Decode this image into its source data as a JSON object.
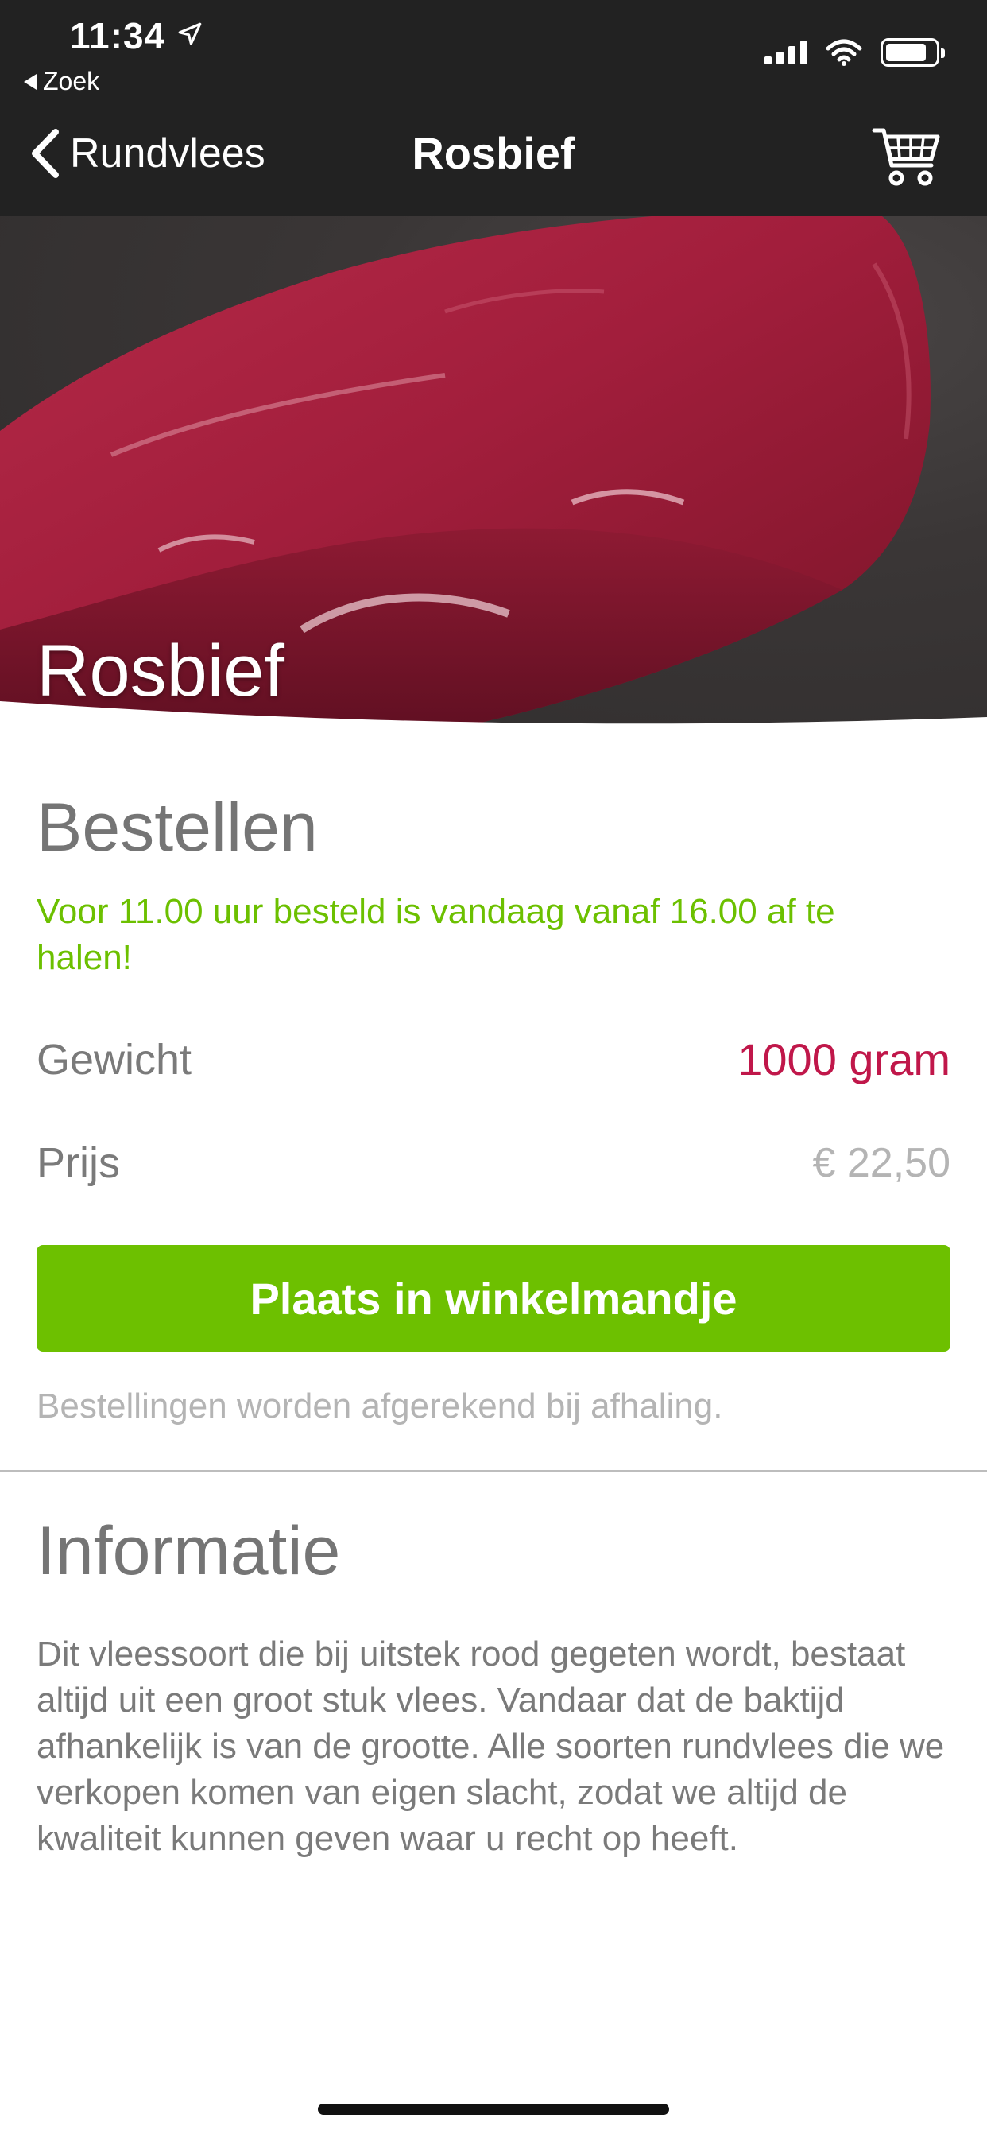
{
  "status_bar": {
    "time": "11:34",
    "back_app_label": "Zoek"
  },
  "nav": {
    "back_label": "Rundvlees",
    "title": "Rosbief"
  },
  "hero": {
    "title": "Rosbief"
  },
  "order": {
    "heading": "Bestellen",
    "notice": "Voor 11.00 uur besteld is vandaag vanaf 16.00 af te halen!",
    "weight_label": "Gewicht",
    "weight_value": "1000 gram",
    "price_label": "Prijs",
    "price_value": "€ 22,50",
    "add_button": "Plaats in winkelmandje",
    "payment_note": "Bestellingen worden afgerekend bij afhaling."
  },
  "info": {
    "heading": "Informatie",
    "text": "Dit vleessoort die bij uitstek rood gegeten wordt, bestaat altijd uit een groot stuk vlees. Vandaar dat de baktijd afhankelijk is van de grootte. Alle soorten rundvlees die we verkopen komen van eigen slacht, zodat we altijd de kwaliteit kunnen geven waar u recht op heeft."
  },
  "colors": {
    "accent_green": "#6dc000",
    "weight_red": "#c0174a",
    "nav_background": "#222222",
    "text_gray": "#7a7a7a"
  },
  "icons": [
    "location-arrow-icon",
    "signal-icon",
    "wifi-icon",
    "battery-icon",
    "chevron-left-icon",
    "cart-icon"
  ]
}
